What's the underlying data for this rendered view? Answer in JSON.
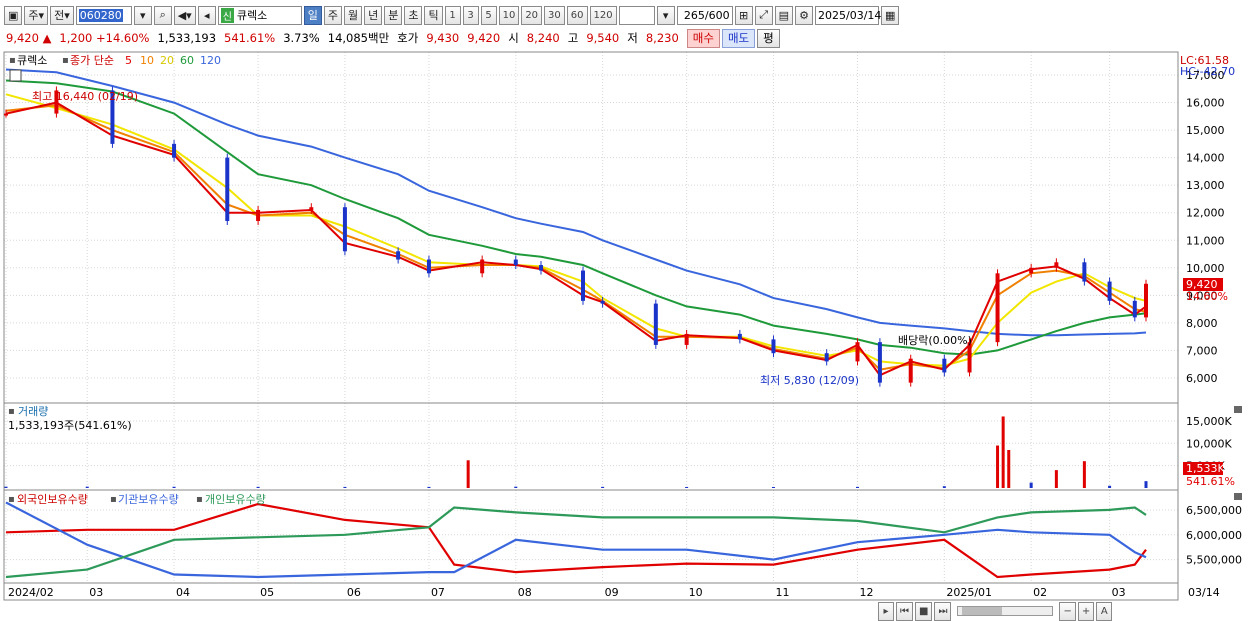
{
  "toolbar": {
    "mode1": "주",
    "mode2": "전",
    "code": "060280",
    "stock_badge": "신",
    "stock_name": "큐렉소",
    "periods": [
      "일",
      "주",
      "월",
      "년",
      "분",
      "초",
      "틱"
    ],
    "selected_period": "일",
    "intervals": [
      "1",
      "3",
      "5",
      "10",
      "20",
      "30",
      "60",
      "120"
    ],
    "count": "265",
    "count_max": "/600",
    "date": "2025/03/14"
  },
  "quote": {
    "price": "9,420 ▲",
    "change": "1,200 +14.60%",
    "volume": "1,533,193",
    "vol_ratio": "541.61%",
    "turnover": "3.73%",
    "amount": "14,085백만",
    "hoga_label": "호가",
    "ask": "9,430",
    "bid": "9,420",
    "open_label": "시",
    "open": "8,240",
    "high_label": "고",
    "high": "9,540",
    "low_label": "저",
    "low": "8,230",
    "buy_label": "매수",
    "sell_label": "매도",
    "extra_label": "평"
  },
  "legend": {
    "price": {
      "name": "큐렉소",
      "series_label": "종가 단순",
      "mas": [
        "5",
        "10",
        "20",
        "60",
        "120"
      ]
    },
    "volume": {
      "title": "거래량",
      "value": "1,533,193주(541.61%)"
    },
    "holdings": [
      "외국인보유수량",
      "기관보유수량",
      "개인보유수량"
    ]
  },
  "colors": {
    "up": "#e00000",
    "down": "#1a33c8",
    "ma5": "#e00000",
    "ma10": "#f08000",
    "ma20": "#f2e600",
    "ma60": "#1f9a3a",
    "ma120": "#3a66dd",
    "foreign": "#e00000",
    "inst": "#3a66dd",
    "indiv": "#2e9a5a"
  },
  "annotations": {
    "lc": "LC:61.58",
    "hc": "HC:-42.70",
    "high_mark": "최고 16,440 (02/19)",
    "low_mark": "최저 5,830 (12/09)",
    "dividend": "배당락(0.00%)",
    "last_price": "9,420",
    "last_pct": "14.60%",
    "last_vol": "1,533K",
    "last_vol_pct": "541.61%"
  },
  "chart_data": [
    {
      "type": "candlestick",
      "title": "큐렉소",
      "y_ticks": [
        "17,000",
        "16,000",
        "15,000",
        "14,000",
        "13,000",
        "12,000",
        "11,000",
        "10,000",
        "9,000",
        "8,000",
        "7,000",
        "6,000"
      ],
      "ylim": [
        5200,
        17400
      ],
      "series": [
        {
          "name": "종가",
          "x": [
            "2024-02-01",
            "2024-02-19",
            "2024-03-10",
            "2024-04-01",
            "2024-04-20",
            "2024-05-01",
            "2024-05-20",
            "2024-06-01",
            "2024-06-20",
            "2024-07-01",
            "2024-07-20",
            "2024-08-01",
            "2024-08-10",
            "2024-08-25",
            "2024-09-01",
            "2024-09-20",
            "2024-10-01",
            "2024-10-20",
            "2024-11-01",
            "2024-11-20",
            "2024-12-01",
            "2024-12-09",
            "2024-12-20",
            "2025-01-01",
            "2025-01-10",
            "2025-01-20",
            "2025-02-01",
            "2025-02-10",
            "2025-02-20",
            "2025-03-01",
            "2025-03-10",
            "2025-03-14"
          ],
          "values": [
            15600,
            16440,
            14500,
            14000,
            11700,
            12100,
            12200,
            10600,
            10300,
            9800,
            10300,
            10100,
            9900,
            8800,
            8700,
            7200,
            7600,
            7400,
            6900,
            6600,
            7300,
            5830,
            6700,
            6200,
            7300,
            9800,
            10000,
            10200,
            9500,
            8800,
            8200,
            9420
          ]
        }
      ],
      "moving_averages": [
        {
          "name": "5",
          "values": [
            15600,
            16000,
            14800,
            14100,
            12000,
            12000,
            12100,
            10900,
            10400,
            9900,
            10200,
            10100,
            9950,
            9000,
            8750,
            7350,
            7550,
            7450,
            7000,
            6650,
            7200,
            6100,
            6600,
            6300,
            7200,
            9500,
            9950,
            10050,
            9600,
            8900,
            8300,
            8600
          ]
        },
        {
          "name": "10",
          "values": [
            15700,
            15900,
            15000,
            14200,
            12300,
            11900,
            12000,
            11200,
            10500,
            10000,
            10100,
            10100,
            10000,
            9200,
            8800,
            7500,
            7500,
            7450,
            7050,
            6700,
            7100,
            6300,
            6500,
            6350,
            7000,
            9000,
            9800,
            9900,
            9700,
            9100,
            8500,
            8400
          ]
        },
        {
          "name": "20",
          "values": [
            16300,
            15800,
            15200,
            14300,
            12900,
            11900,
            11900,
            11500,
            10700,
            10200,
            10100,
            10100,
            10050,
            9500,
            8900,
            7800,
            7500,
            7500,
            7150,
            6800,
            7000,
            6600,
            6500,
            6450,
            6700,
            8000,
            9100,
            9500,
            9800,
            9300,
            8900,
            8800
          ]
        },
        {
          "name": "60",
          "values": [
            16800,
            16700,
            16400,
            15600,
            14200,
            13400,
            13000,
            12500,
            11800,
            11200,
            10800,
            10500,
            10400,
            10100,
            9800,
            9000,
            8600,
            8300,
            7900,
            7600,
            7400,
            7200,
            7100,
            6900,
            6850,
            7000,
            7400,
            7700,
            8000,
            8200,
            8300,
            8350
          ]
        },
        {
          "name": "120",
          "values": [
            17200,
            17100,
            16600,
            16000,
            15200,
            14800,
            14400,
            14000,
            13400,
            12800,
            12200,
            11800,
            11600,
            11300,
            11000,
            10300,
            9900,
            9400,
            8900,
            8500,
            8200,
            8000,
            7900,
            7800,
            7700,
            7600,
            7550,
            7550,
            7580,
            7600,
            7620,
            7650
          ]
        }
      ]
    },
    {
      "type": "bar",
      "title": "거래량",
      "y_ticks": [
        "15,000K",
        "10,000K",
        "5,000K"
      ],
      "ylim": [
        0,
        17000
      ],
      "unit": "K",
      "categories": [
        "2024-02",
        "2024-03",
        "2024-04",
        "2024-05",
        "2024-06",
        "2024-07",
        "2024-07-15",
        "2024-08",
        "2024-09",
        "2024-10",
        "2024-11",
        "2024-12",
        "2025-01",
        "2025-01-20",
        "2025-01-22",
        "2025-01-24",
        "2025-02",
        "2025-02-10",
        "2025-02-20",
        "2025-03",
        "2025-03-14"
      ],
      "values": [
        300,
        300,
        280,
        260,
        250,
        250,
        6200,
        300,
        260,
        240,
        230,
        260,
        400,
        9500,
        16000,
        8500,
        1200,
        4000,
        6000,
        500,
        1533
      ]
    },
    {
      "type": "line",
      "title": "보유수량",
      "y_ticks": [
        "6,500,000",
        "6,000,000",
        "5,500,000"
      ],
      "ylim": [
        5050000,
        6700000
      ],
      "x": [
        "2024-02",
        "2024-03",
        "2024-04",
        "2024-05",
        "2024-06",
        "2024-07",
        "2024-07-10",
        "2024-08",
        "2024-09",
        "2024-10",
        "2024-11",
        "2024-12",
        "2025-01",
        "2025-01-20",
        "2025-02",
        "2025-03",
        "2025-03-10",
        "2025-03-14"
      ],
      "series": [
        {
          "name": "외국인보유수량",
          "values": [
            6050000,
            6100000,
            6100000,
            6620000,
            6300000,
            6150000,
            5400000,
            5250000,
            5350000,
            5420000,
            5400000,
            5700000,
            5900000,
            5150000,
            5200000,
            5300000,
            5400000,
            5700000
          ]
        },
        {
          "name": "기관보유수량",
          "values": [
            6650000,
            5800000,
            5200000,
            5150000,
            5200000,
            5250000,
            5250000,
            5900000,
            5700000,
            5700000,
            5500000,
            5850000,
            6000000,
            6100000,
            6050000,
            6000000,
            5650000,
            5550000
          ]
        },
        {
          "name": "개인보유수량",
          "values": [
            5150000,
            5300000,
            5900000,
            5950000,
            6000000,
            6150000,
            6550000,
            6450000,
            6350000,
            6350000,
            6350000,
            6280000,
            6050000,
            6350000,
            6450000,
            6500000,
            6550000,
            6400000
          ]
        }
      ]
    }
  ],
  "x_axis": [
    "2024/02",
    "03",
    "04",
    "05",
    "06",
    "07",
    "08",
    "09",
    "10",
    "11",
    "12",
    "2025/01",
    "02",
    "03",
    "03/14"
  ]
}
